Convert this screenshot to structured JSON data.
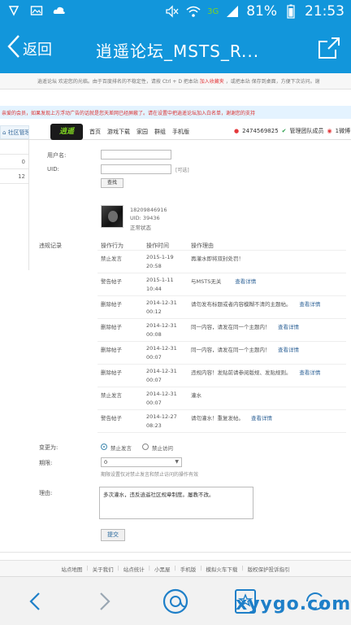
{
  "status_bar": {
    "battery_percent": "81%",
    "time": "21:53",
    "network": "3G"
  },
  "titlebar": {
    "back_label": "返回",
    "title": "逍遥论坛_MSTS_R..."
  },
  "notices": {
    "top": "逍遥论坛  欢迎您的光临。由于百度排名的不稳定性，请按 Ctrl + D 把本站",
    "top_red": "加入收藏夹",
    "top_tail": "，或把本站 保存到桌面，方便下次访问。谢",
    "second": "亲爱的会员，如果发现上方浮动广告的话就是您天差网已经屏蔽了。请在设置中把逍遥论坛加入白名单，谢谢您的支持"
  },
  "nav": {
    "left_tab": "社区管理",
    "logo_text": "逍遥",
    "links": [
      "首页",
      "游戏下载",
      "家园",
      "群组",
      "手机版"
    ],
    "user_id": "2474569825",
    "user_group": "管理团队成员",
    "weibo": "1微博"
  },
  "sidebar": {
    "values": [
      "",
      "0",
      "12"
    ]
  },
  "search_form": {
    "username_label": "用户名:",
    "uid_label": "UID:",
    "uid_hint": "[可选]",
    "search_button": "查找"
  },
  "user_info": {
    "name": "18209846916",
    "uid": "UID:  39436",
    "status": "正常状态"
  },
  "violations": {
    "section_label": "违规记录",
    "headers": [
      "操作行为",
      "操作时间",
      "操作理由"
    ],
    "rows": [
      {
        "action": "禁止发言",
        "date": "2015-1-19",
        "time": "20:58",
        "reason": "再灌水即将双封处罚！",
        "detail": ""
      },
      {
        "action": "警告帖子",
        "date": "2015-1-11",
        "time": "10:44",
        "reason": "与MSTS无关",
        "detail": "查看详情"
      },
      {
        "action": "删除帖子",
        "date": "2014-12-31",
        "time": "00:12",
        "reason": "请勿发布标题或者内容模糊不清的主题帖。",
        "detail": "查看详情"
      },
      {
        "action": "删除帖子",
        "date": "2014-12-31",
        "time": "00:08",
        "reason": "同一内容，请发在同一个主题内！",
        "detail": "查看详情"
      },
      {
        "action": "删除帖子",
        "date": "2014-12-31",
        "time": "00:07",
        "reason": "同一内容，请发在同一个主题内！",
        "detail": "查看详情"
      },
      {
        "action": "删除帖子",
        "date": "2014-12-31",
        "time": "00:07",
        "reason": "违规内容！发贴前请参阅版规、发贴规则。",
        "detail": "查看详情"
      },
      {
        "action": "禁止发言",
        "date": "2014-12-31",
        "time": "00:07",
        "reason": "灌水",
        "detail": ""
      },
      {
        "action": "警告帖子",
        "date": "2014-12-27",
        "time": "08:23",
        "reason": "请勿灌水！重复发帖。",
        "detail": "查看详情"
      }
    ]
  },
  "change_form": {
    "change_label": "变更为:",
    "option_ban": "禁止发言",
    "option_ban_visit": "禁止访问",
    "period_label": "期限:",
    "period_value": "0",
    "period_hint": "期限设置仅对禁止发言和禁止访问的操作有效",
    "reason_label": "理由:",
    "reason_value": "多次灌水，违反逍遥社区规章制度。屡教不改。",
    "submit_label": "提交"
  },
  "footer": {
    "links": [
      "站点地图",
      "关于我们",
      "站点统计",
      "小黑屋",
      "手机版",
      "模拟火车下载",
      "版权保护投诉指引"
    ]
  },
  "watermark": "xyygo.com",
  "colors": {
    "brand": "#1296db",
    "link": "#336699",
    "alert": "#e4393c"
  }
}
